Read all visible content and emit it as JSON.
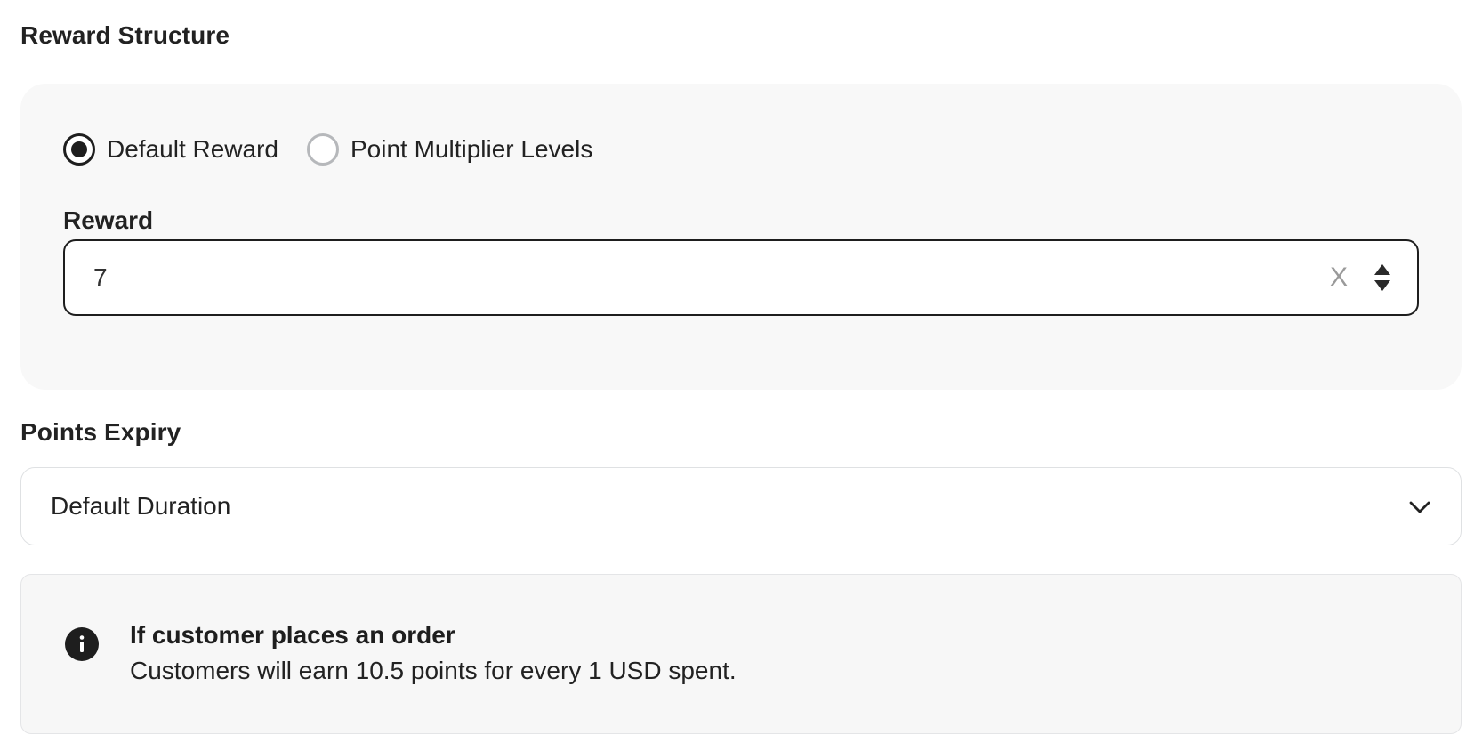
{
  "reward_structure": {
    "title": "Reward Structure",
    "options": [
      {
        "label": "Default Reward",
        "selected": true
      },
      {
        "label": "Point Multiplier Levels",
        "selected": false
      }
    ],
    "reward_field": {
      "label": "Reward",
      "value": "7",
      "suffix": "X",
      "stepper_icon": "sort-up-down-icon"
    }
  },
  "points_expiry": {
    "title": "Points Expiry",
    "selected_value": "Default Duration",
    "dropdown_icon": "chevron-down-icon"
  },
  "info": {
    "icon": "info-circle-icon",
    "title": "If customer places an order",
    "text": "Customers will earn 10.5 points for every 1 USD spent."
  },
  "colors": {
    "text": "#222222",
    "accent": "#1e1e1e",
    "card_bg": "#f8f8f8",
    "border": "#dfe1e3",
    "muted": "#9a9a9a"
  }
}
